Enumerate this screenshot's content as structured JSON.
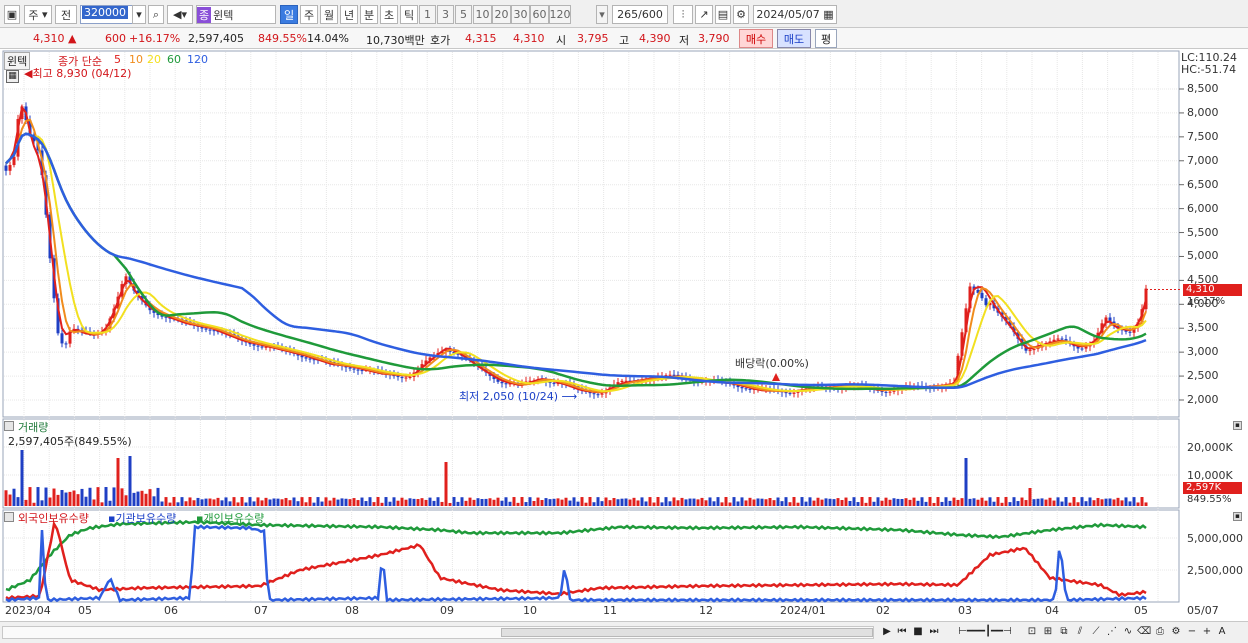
{
  "toolbar": {
    "period_label": "주",
    "all_label": "전",
    "code": "320000",
    "type_badge": "종",
    "stock_name": "윈텍",
    "period_tabs": [
      "일",
      "주",
      "월",
      "년",
      "분",
      "초",
      "틱"
    ],
    "active_period": "일",
    "minute_tabs": [
      "1",
      "3",
      "5",
      "10",
      "20",
      "30",
      "60",
      "120"
    ],
    "range": "265",
    "range_max": "/600",
    "date": "2024/05/07"
  },
  "quote": {
    "price": "4,310",
    "change": "600",
    "change_pct": "+16.17%",
    "volume": "2,597,405",
    "vol_ratio": "849.55%",
    "turnover": "14.04%",
    "amount": "10,730백만",
    "ask_label": "호가",
    "ask": "4,315",
    "bid": "4,310",
    "open_label": "시",
    "open": "3,795",
    "high_label": "고",
    "high": "4,390",
    "low_label": "저",
    "low": "3,790",
    "buy_btn": "매수",
    "sell_btn": "매도",
    "eval_btn": "평"
  },
  "price_panel": {
    "stock_tag": "윈텍",
    "ma_title": "종가 단순",
    "ma_periods": [
      "5",
      "10",
      "20",
      "60",
      "120"
    ],
    "high_note": "최고 8,930 (04/12)",
    "low_note": "최저 2,050 (10/24)",
    "dividend_note": "배당락(0.00%)",
    "lc": "LC:110.24",
    "hc": "HC:-51.74",
    "y_ticks": [
      "8,500",
      "8,000",
      "7,500",
      "7,000",
      "6,500",
      "6,000",
      "5,500",
      "5,000",
      "4,500",
      "4,000",
      "3,500",
      "3,000",
      "2,500",
      "2,000"
    ],
    "current_price": "4,310",
    "current_pct": "16.17%"
  },
  "volume_panel": {
    "title": "거래량",
    "value": "2,597,405주(849.55%)",
    "y_ticks": [
      "20,000K",
      "10,000K"
    ],
    "current": "2,597K",
    "current_pct": "849.55%"
  },
  "holdings_panel": {
    "series": [
      "외국인보유수량",
      "기관보유수량",
      "개인보유수량"
    ],
    "y_ticks": [
      "5,000,000",
      "2,500,000"
    ]
  },
  "x_axis": [
    "2023/04",
    "05",
    "06",
    "07",
    "08",
    "09",
    "10",
    "11",
    "12",
    "2024/01",
    "02",
    "03",
    "04",
    "05",
    "05/07"
  ],
  "colors": {
    "up": "#e0201d",
    "down": "#1f3fc4",
    "ma5": "#e0201d",
    "ma10": "#f08c1c",
    "ma20": "#f2e020",
    "ma60": "#1f9a3a",
    "ma120": "#2e5ee0"
  }
}
